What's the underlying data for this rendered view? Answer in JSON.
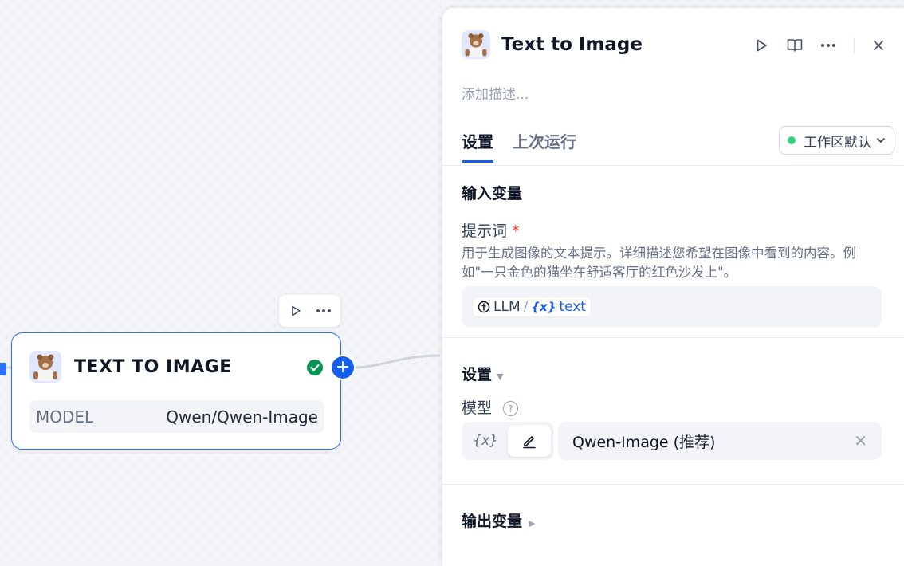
{
  "canvas": {
    "node": {
      "title": "TEXT TO IMAGE",
      "model_label": "MODEL",
      "model_value": "Qwen/Qwen-Image",
      "add_label": "+"
    },
    "colors": {
      "accent": "#155eef",
      "success": "#12b76a"
    }
  },
  "panel": {
    "title": "Text to Image",
    "description_placeholder": "添加描述...",
    "tabs": [
      {
        "label": "设置",
        "active": true
      },
      {
        "label": "上次运行",
        "active": false
      }
    ],
    "workspace": {
      "label": "工作区默认"
    },
    "inputs": {
      "section_title": "输入变量",
      "prompt": {
        "label": "提示词",
        "required_mark": "*",
        "help": "用于生成图像的文本提示。详细描述您希望在图像中看到的内容。例如\"一只金色的猫坐在舒适客厅的红色沙发上\"。",
        "source": "LLM",
        "separator": "/",
        "var_prefix": "{x}",
        "variable": "text"
      }
    },
    "settings": {
      "section_title": "设置",
      "model_label": "模型",
      "help_mark": "?",
      "var_mode": "{x}",
      "model_value": "Qwen-Image (推荐)",
      "clear_symbol": "✕"
    },
    "outputs": {
      "section_title": "输出变量"
    }
  },
  "icons": [
    "play-icon",
    "more-icon",
    "check-circle-icon",
    "plus-icon",
    "book-icon",
    "close-icon",
    "chevron-down-icon",
    "pencil-icon",
    "help-icon",
    "tool-avatar-icon"
  ]
}
